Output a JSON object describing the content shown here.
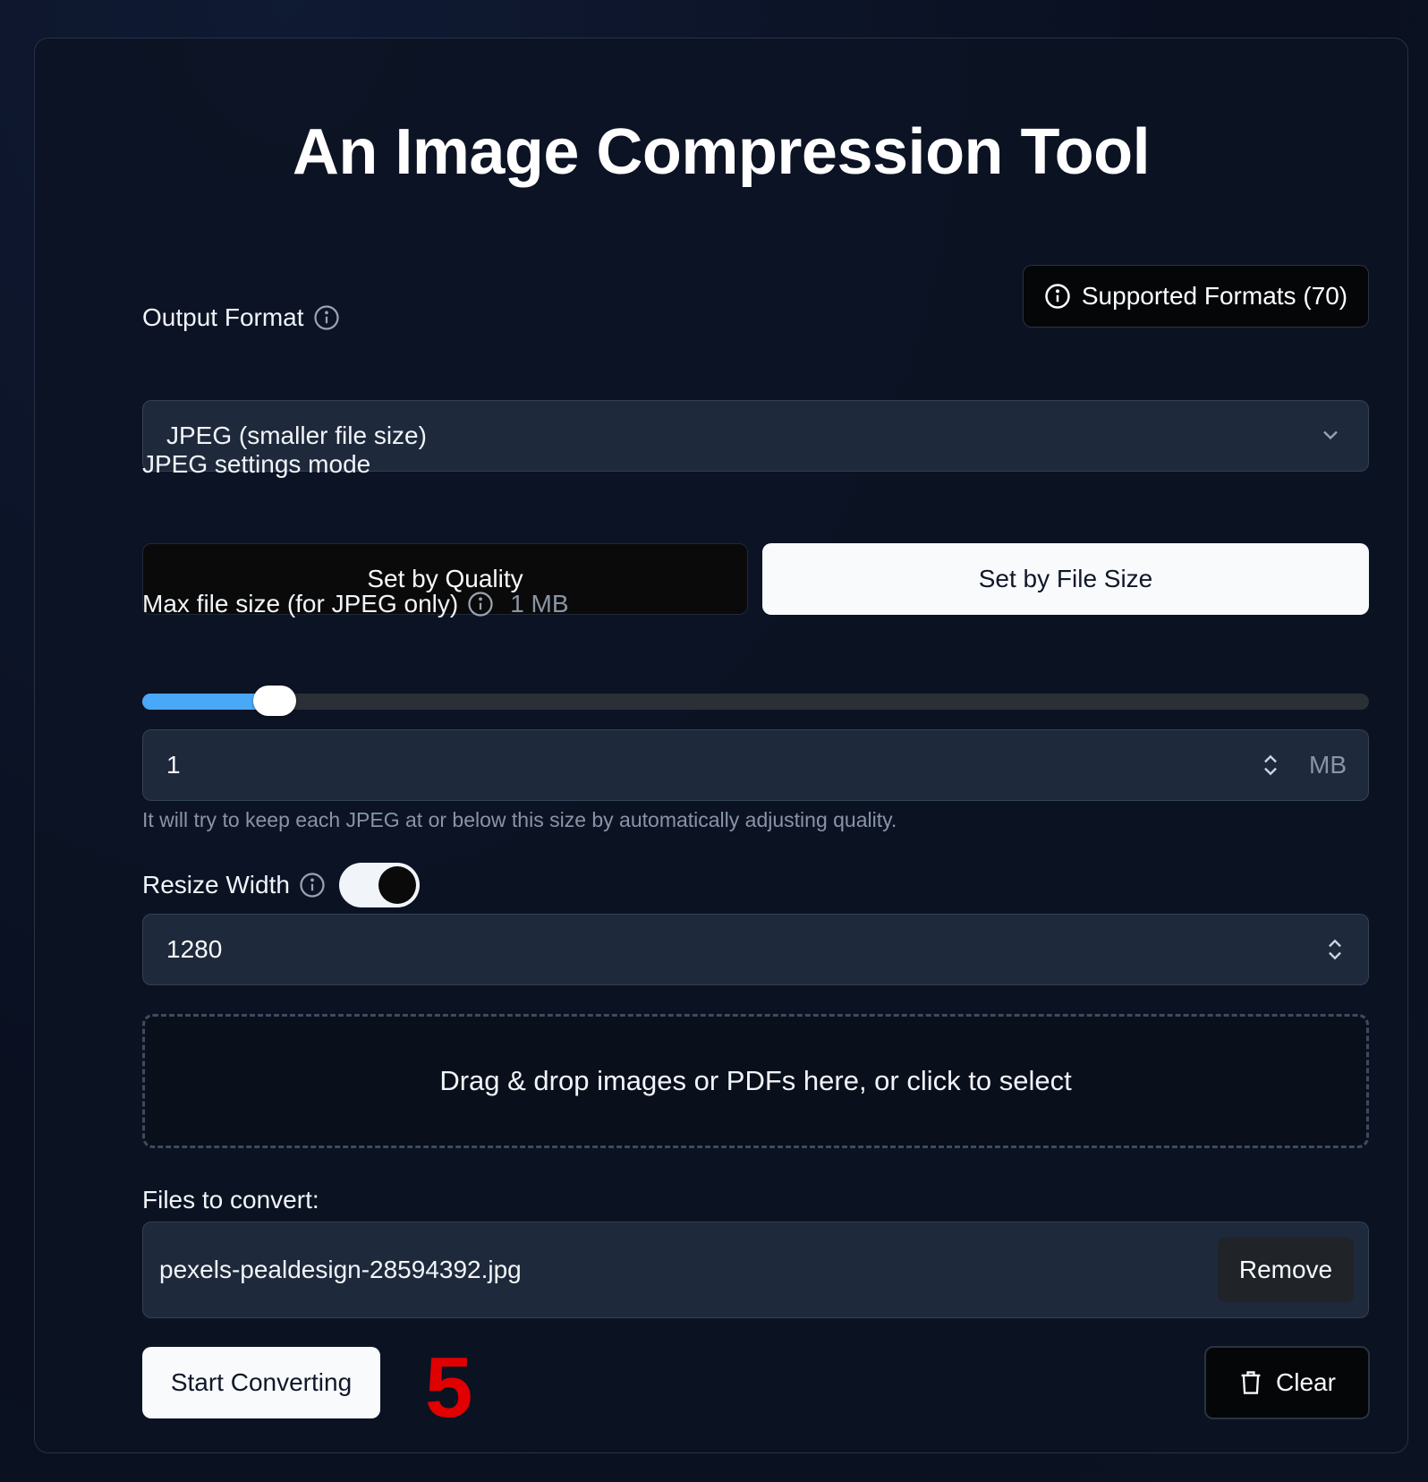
{
  "header": {
    "title": "An Image Compression Tool"
  },
  "formats": {
    "label": "Supported Formats (70)"
  },
  "output_format": {
    "label": "Output Format",
    "selected": "JPEG (smaller file size)"
  },
  "jpeg_mode": {
    "label": "JPEG settings mode",
    "options": [
      "Set by Quality",
      "Set by File Size"
    ],
    "active": "Set by File Size"
  },
  "max_size": {
    "label": "Max file size (for JPEG only)",
    "display_value": "1 MB",
    "slider_fraction": 0.108,
    "input_value": "1",
    "unit": "MB",
    "hint": "It will try to keep each JPEG at or below this size by automatically adjusting quality."
  },
  "resize": {
    "label": "Resize Width",
    "enabled": true,
    "value": "1280"
  },
  "dropzone": {
    "text": "Drag & drop images or PDFs here, or click to select"
  },
  "files": {
    "label": "Files to convert:",
    "items": [
      {
        "name": "pexels-pealdesign-28594392.jpg",
        "remove_label": "Remove"
      }
    ]
  },
  "actions": {
    "start_label": "Start Converting",
    "step_marker": "5",
    "clear_label": "Clear"
  },
  "colors": {
    "accent": "#4aa8f8",
    "marker": "#e00000",
    "background": "#0a1020"
  }
}
